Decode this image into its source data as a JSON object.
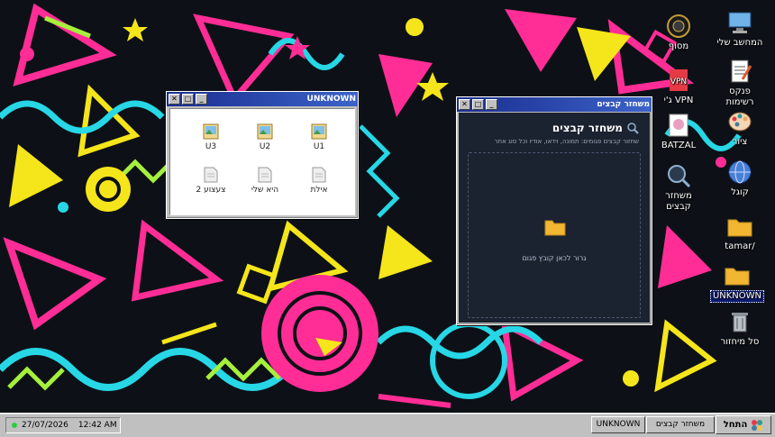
{
  "desktop": {
    "icons": [
      {
        "label": "המחשב שלי",
        "glyph": "computer-icon"
      },
      {
        "label": "מסוף",
        "glyph": "terminal-icon"
      },
      {
        "label": "פנקס רשימות",
        "glyph": "notepad-icon"
      },
      {
        "label": "ג'י VPN",
        "glyph": "vpn-icon"
      },
      {
        "label": "ציור",
        "glyph": "paint-icon"
      },
      {
        "label": "BATZAL",
        "glyph": "batzal-icon"
      },
      {
        "label": "קוגל",
        "glyph": "globe-icon"
      },
      {
        "label": "משחזר קבצים",
        "glyph": "recovery-icon"
      },
      {
        "label": "tamar/",
        "glyph": "folder-icon"
      },
      {
        "label": "UNKNOWN",
        "glyph": "folder-icon"
      },
      {
        "label": "סל מיחזור",
        "glyph": "recycle-bin-icon"
      }
    ]
  },
  "win_unknown": {
    "title": "UNKNOWN",
    "files": [
      {
        "label": "U1",
        "type": "image"
      },
      {
        "label": "U2",
        "type": "image"
      },
      {
        "label": "U3",
        "type": "image"
      },
      {
        "label": "אילת",
        "type": "document"
      },
      {
        "label": "היא שלי",
        "type": "document"
      },
      {
        "label": "צעצוע 2",
        "type": "document"
      }
    ]
  },
  "win_scanner": {
    "title": "משחזר קבצים",
    "heading": "משחזר קבצים",
    "subtitle": "שחזור קבצים פגומים: תמונה, וידאו, אודיו וכל סוג אחר",
    "drop_text": "גרור לכאן קובץ פגום"
  },
  "taskbar": {
    "date": "27/07/2026",
    "time": "12:42 AM",
    "tasks": [
      "UNKNOWN",
      "משחזר קבצים"
    ],
    "start_label": "התחל"
  },
  "colors": {
    "title_bar": "#1a2d8f",
    "accent": "#f5c542",
    "selection": "#0b1a6e"
  }
}
